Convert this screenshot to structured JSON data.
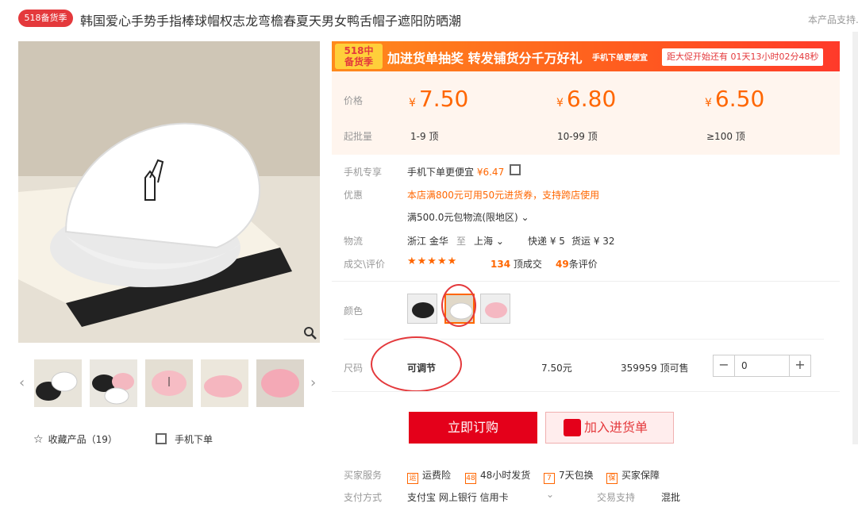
{
  "title": {
    "badge": "518备货季",
    "text": "韩国爱心手势手指棒球帽权志龙弯檐春夏天男女鸭舌帽子遮阳防晒潮",
    "support_text": "本产品支持..."
  },
  "gallery": {
    "prev_icon": "chevron-left-icon",
    "next_icon": "chevron-right-icon",
    "zoom_icon": "magnifier-icon",
    "favorite_label": "收藏产品（19）",
    "mobile_order_label": "手机下单"
  },
  "promo": {
    "tag_line1": "518中",
    "tag_line2": "备货季",
    "main_text": "加进货单抽奖 转发铺货分千万好礼",
    "sub_text": "手机下单更便宜",
    "countdown": "距大促开始还有 01天13小时02分48秒"
  },
  "pricing": {
    "price_label": "价格",
    "batch_label": "起批量",
    "currency": "¥",
    "tiers": [
      {
        "price": "7.50",
        "range": "1-9 顶"
      },
      {
        "price": "6.80",
        "range": "10-99 顶"
      },
      {
        "price": "6.50",
        "range": "≥100 顶"
      }
    ]
  },
  "details": {
    "mobile_label": "手机专享",
    "mobile_value": "手机下单更便宜",
    "mobile_price": "¥6.47",
    "discount_label": "优惠",
    "discount_value": "本店满800元可用50元进货券，支持跨店使用",
    "shipping_promo": "满500.0元包物流(限地区)",
    "logistics_label": "物流",
    "from": "浙江  金华",
    "to_word": "至",
    "to": "上海",
    "express": "快递 ¥ 5",
    "freight": "货运 ¥ 32",
    "deal_label": "成交\\评价",
    "stars": "★★★★★",
    "deals_count": "134",
    "deals_suffix": "顶成交",
    "reviews_count": "49",
    "reviews_suffix": "条评价"
  },
  "options": {
    "color_label": "颜色",
    "size_label": "尺码",
    "size_value": "可调节",
    "size_price": "7.50元",
    "stock": "359959 顶可售",
    "quantity": "0",
    "minus": "−",
    "plus": "+"
  },
  "actions": {
    "buy_now": "立即订购",
    "add_cart": "加入进货单"
  },
  "services": {
    "label": "买家服务",
    "items": [
      {
        "icon": "freight-insurance-icon",
        "glyph": "运",
        "text": "运费险"
      },
      {
        "icon": "48h-ship-icon",
        "glyph": "48",
        "text": "48小时发货"
      },
      {
        "icon": "7day-return-icon",
        "glyph": "7",
        "text": "7天包换"
      },
      {
        "icon": "buyer-guarantee-icon",
        "glyph": "保",
        "text": "买家保障"
      }
    ]
  },
  "payment": {
    "label": "支付方式",
    "methods": "支付宝   网上银行   信用卡",
    "trade_label": "交易支持",
    "trade_value": "混批"
  },
  "colors": {
    "accent": "#e4393c",
    "price": "#ff6600"
  }
}
